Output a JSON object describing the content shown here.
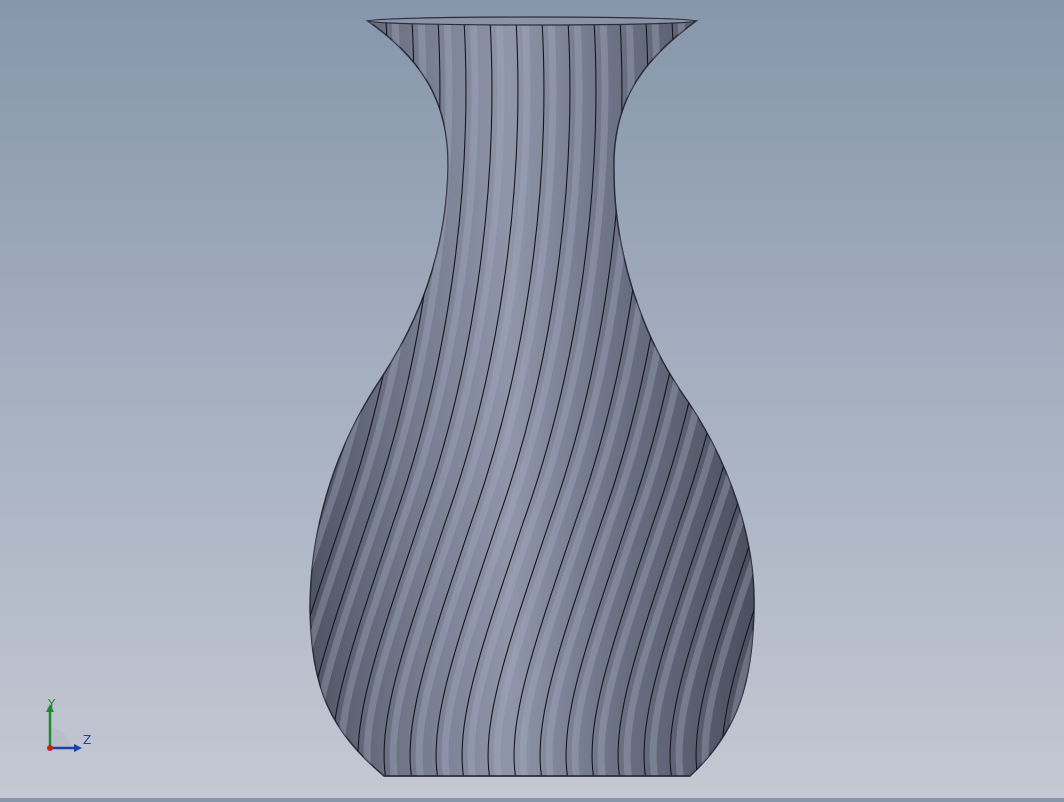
{
  "viewport": {
    "background_top": "#8796ab",
    "background_bottom": "#c4c8d3",
    "model": {
      "name": "vase",
      "body_color": "#6f7587",
      "highlight_color": "#a9b0c2",
      "edge_color": "#15161c",
      "twisted_flutes": 14
    }
  },
  "triad": {
    "y_label": "Y",
    "z_label": "Z",
    "y_color": "#1d8a2b",
    "z_color": "#1f3fae",
    "origin_color": "#c81e1e"
  }
}
